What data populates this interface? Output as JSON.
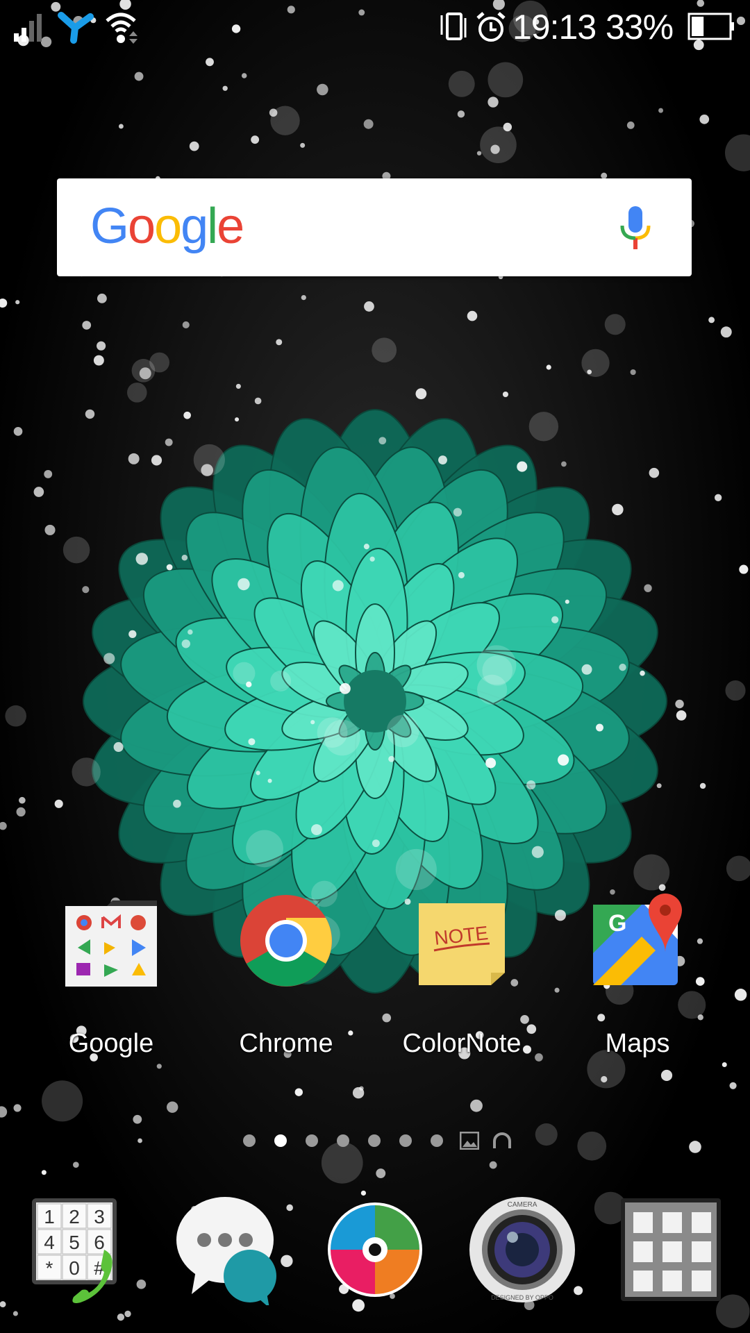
{
  "status_bar": {
    "time": "19:13",
    "battery_percent": "33%",
    "battery_level": 0.33,
    "icons": [
      "signal-icon",
      "network-hub-icon",
      "wifi-icon",
      "vibrate-icon",
      "alarm-icon",
      "battery-icon"
    ],
    "accent": "#1a9ce8"
  },
  "search": {
    "logo": "Google",
    "mic_icon": "mic-icon"
  },
  "apps": [
    {
      "label": "Google",
      "icon": "google-folder-icon"
    },
    {
      "label": "Chrome",
      "icon": "chrome-icon"
    },
    {
      "label": "ColorNote",
      "icon": "colornote-icon",
      "icon_text": "NOTE"
    },
    {
      "label": "Maps",
      "icon": "maps-icon"
    }
  ],
  "page_indicator": {
    "pages": 7,
    "current": 2,
    "extra_icons": [
      "gallery-icon",
      "headphones-icon"
    ]
  },
  "dock": [
    {
      "name": "phone",
      "icon": "dialer-icon",
      "keys": [
        "1",
        "2",
        "3",
        "4",
        "5",
        "6",
        "*",
        "0",
        "#"
      ]
    },
    {
      "name": "messages",
      "icon": "messages-icon"
    },
    {
      "name": "music",
      "icon": "music-disc-icon"
    },
    {
      "name": "camera",
      "icon": "camera-icon",
      "ring_top": "CAMERA",
      "ring_bottom": "DESIGNED BY OPPO"
    },
    {
      "name": "app-drawer",
      "icon": "app-drawer-icon"
    }
  ]
}
